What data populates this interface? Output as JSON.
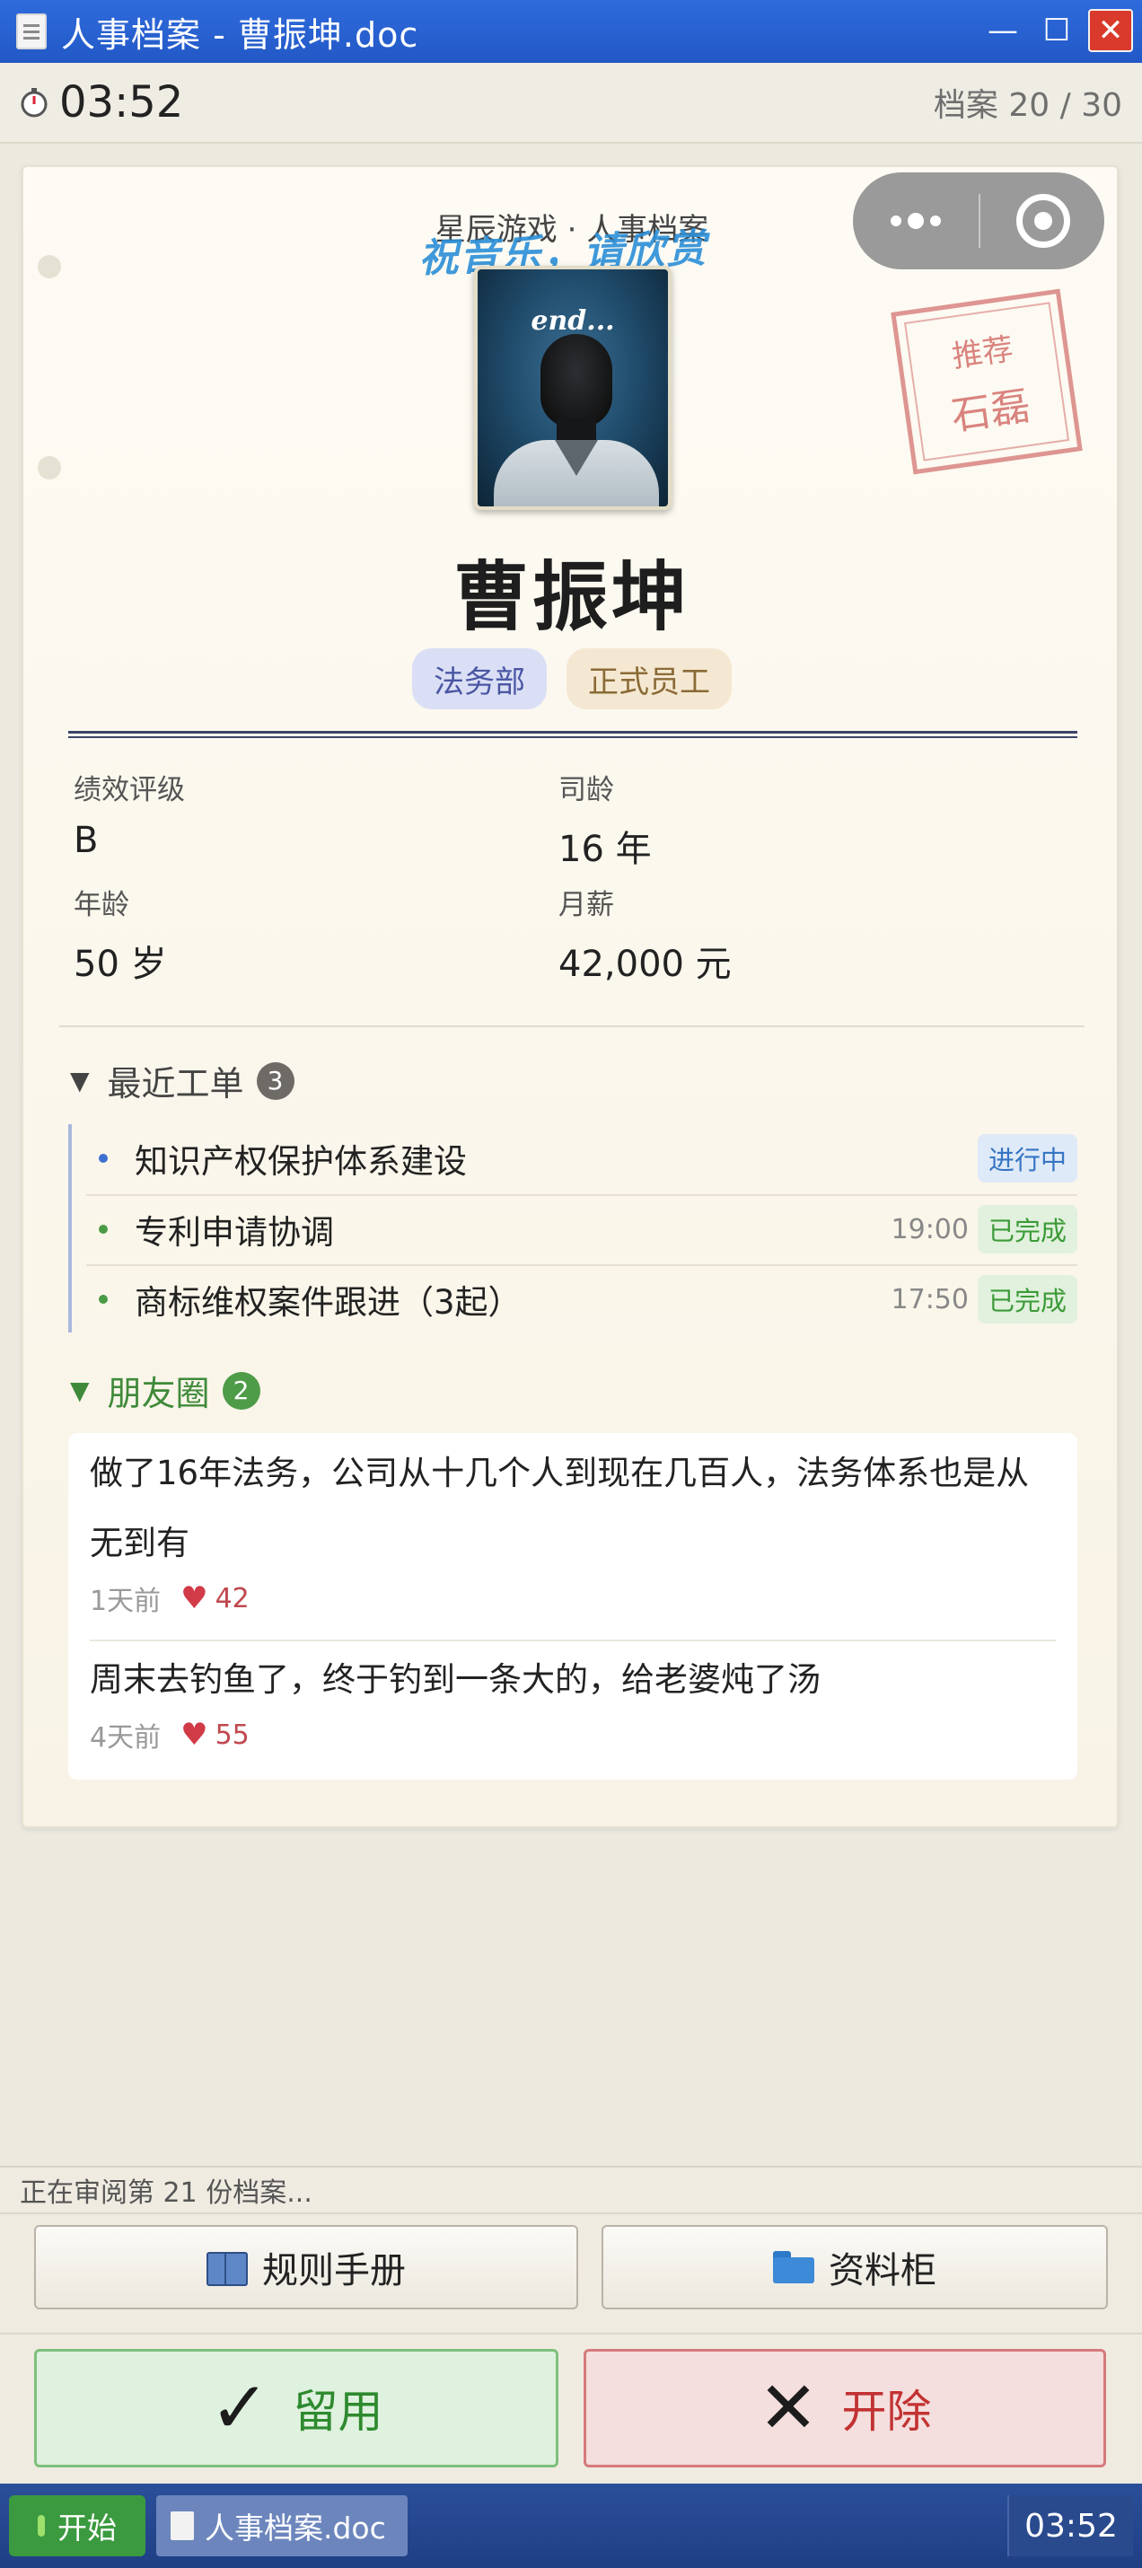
{
  "window": {
    "title": "人事档案 - 曹振坤.doc",
    "buttons": {
      "minimize": "—",
      "maximize": "☐",
      "close": "✕"
    }
  },
  "infobar": {
    "timer": "03:52",
    "file_count": "档案 20 / 30"
  },
  "card": {
    "header": "星辰游戏 · 人事档案",
    "header_watermark": "祝音乐，请欣赏",
    "stamp": {
      "line1": "推荐",
      "line2": "石磊"
    },
    "photo_caption": "end...",
    "name": "曹振坤",
    "tags": {
      "department": "法务部",
      "status": "正式员工"
    },
    "fields": [
      {
        "label": "绩效评级",
        "value": "B"
      },
      {
        "label": "司龄",
        "value": "16 年"
      },
      {
        "label": "年龄",
        "value": "50 岁"
      },
      {
        "label": "月薪",
        "value": "42,000 元"
      }
    ],
    "orders_section": {
      "title": "最近工单",
      "count": "3",
      "items": [
        {
          "text": "知识产权保护体系建设",
          "time": "",
          "status": "进行中",
          "dot_color": "#3e6fd0"
        },
        {
          "text": "专利申请协调",
          "time": "19:00",
          "status": "已完成",
          "dot_color": "#4a9b45"
        },
        {
          "text": "商标维权案件跟进（3起）",
          "time": "17:50",
          "status": "已完成",
          "dot_color": "#4a9b45"
        }
      ]
    },
    "moments_section": {
      "title": "朋友圈",
      "count": "2",
      "items": [
        {
          "text": "做了16年法务，公司从十几个人到现在几百人，法务体系也是从无到有",
          "time": "1天前",
          "likes": "42"
        },
        {
          "text": "周末去钓鱼了，终于钓到一条大的，给老婆炖了汤",
          "time": "4天前",
          "likes": "55"
        }
      ]
    }
  },
  "status_line": "正在审阅第 21 份档案...",
  "tools": {
    "handbook": "规则手册",
    "cabinet": "资料柜"
  },
  "decision": {
    "keep": "留用",
    "fire": "开除"
  },
  "taskbar": {
    "start": "开始",
    "task": "人事档案.doc",
    "clock": "03:52"
  }
}
